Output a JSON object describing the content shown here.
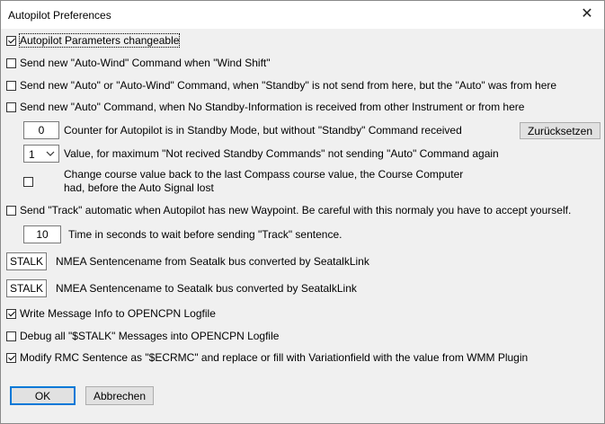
{
  "window": {
    "title": "Autopilot Preferences",
    "close_icon": "close-icon"
  },
  "options": {
    "params_changeable": {
      "label": "Autopilot Parameters changeable",
      "checked": true
    },
    "auto_wind": {
      "label": "Send new \"Auto-Wind\" Command when \"Wind Shift\"",
      "checked": false
    },
    "auto_standby": {
      "label": "Send new \"Auto\" or \"Auto-Wind\" Command, when \"Standby\" is not send from here, but the \"Auto\" was from here",
      "checked": false
    },
    "auto_no_standby": {
      "label": "Send new \"Auto\" Command, when No Standby-Information is received from other Instrument or from here",
      "checked": false
    },
    "counter": {
      "value": "0",
      "label": "Counter for Autopilot is in Standby Mode, but without \"Standby\" Command received",
      "reset_label": "Zurücksetzen"
    },
    "max_value": {
      "selected": "1",
      "label": "Value, for maximum  \"Not recived Standby Commands\" not sending \"Auto\" Command again"
    },
    "change_course": {
      "line1": "Change course value back to the last Compass course value, the Course Computer",
      "line2": "had, before the Auto Signal lost",
      "checked": false
    },
    "send_track": {
      "label": "Send \"Track\" automatic when Autopilot has new Waypoint. Be careful with this normaly you have to accept yourself.",
      "checked": false
    },
    "track_wait": {
      "value": "10",
      "label": "Time in seconds to wait before sending \"Track\" sentence."
    },
    "stalk_from": {
      "value": "STALK",
      "label": "NMEA Sentencename from  Seatalk bus converted by SeatalkLink"
    },
    "stalk_to": {
      "value": "STALK",
      "label": "NMEA Sentencename to Seatalk bus converted by SeatalkLink"
    },
    "write_log": {
      "label": "Write Message Info to OPENCPN Logfile",
      "checked": true
    },
    "debug_stalk": {
      "label": "Debug all \"$STALK\" Messages into OPENCPN Logfile",
      "checked": false
    },
    "modify_rmc": {
      "label": "Modify RMC Sentence as \"$ECRMC\" and replace or fill with Variationfield with the value from WMM Plugin",
      "checked": true
    }
  },
  "buttons": {
    "ok": "OK",
    "cancel": "Abbrechen"
  },
  "colors": {
    "dialog_bg": "#f0f0f0",
    "titlebar_bg": "#ffffff",
    "default_button_border": "#0078d7"
  }
}
